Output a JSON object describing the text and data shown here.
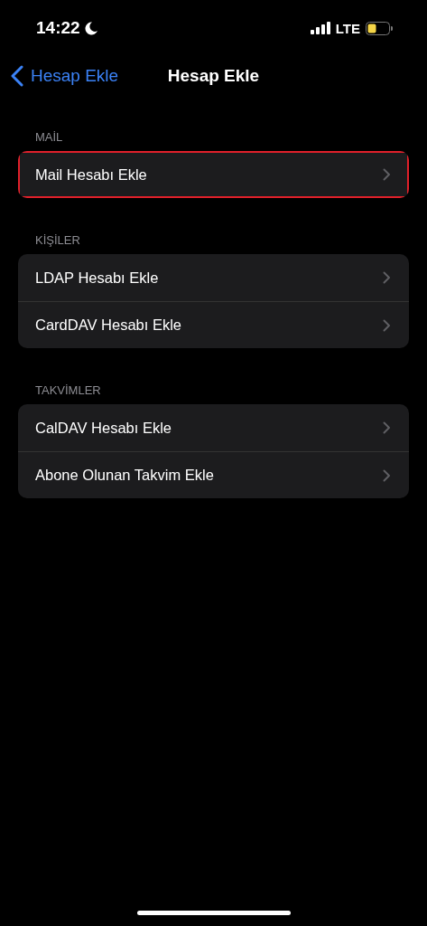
{
  "status_bar": {
    "time": "14:22",
    "network": "LTE"
  },
  "nav": {
    "back": "Hesap Ekle",
    "title": "Hesap Ekle"
  },
  "sections": [
    {
      "header": "MAİL",
      "items": [
        {
          "label": "Mail Hesabı Ekle",
          "highlighted": true
        }
      ]
    },
    {
      "header": "KİŞİLER",
      "items": [
        {
          "label": "LDAP Hesabı Ekle",
          "highlighted": false
        },
        {
          "label": "CardDAV Hesabı Ekle",
          "highlighted": false
        }
      ]
    },
    {
      "header": "TAKVİMLER",
      "items": [
        {
          "label": "CalDAV Hesabı Ekle",
          "highlighted": false
        },
        {
          "label": "Abone Olunan Takvim Ekle",
          "highlighted": false
        }
      ]
    }
  ]
}
